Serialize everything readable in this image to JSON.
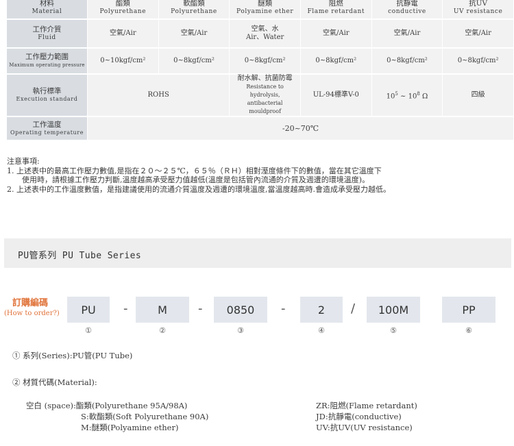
{
  "table": {
    "header_row": {
      "label_zh": "材料",
      "label_en": "Material",
      "cols": [
        {
          "zh": "酯類",
          "en": "Polyurethane"
        },
        {
          "zh": "軟酯類",
          "en": "Polyurethane"
        },
        {
          "zh": "醚類",
          "en": "Polyamine ether"
        },
        {
          "zh": "阻燃",
          "en": "Flame retardant"
        },
        {
          "zh": "抗靜電",
          "en": "conductive"
        },
        {
          "zh": "抗UV",
          "en": "UV resistance"
        }
      ]
    },
    "fluid_row": {
      "label_zh": "工作介質",
      "label_en": "Fluid",
      "cols": [
        "空氣/Air",
        "空氣/Air",
        "空氣、水",
        "空氣/Air",
        "空氣/Air",
        "空氣/Air"
      ],
      "col3_line2": "Air、Water"
    },
    "pressure_row": {
      "label_zh": "工作壓力範圍",
      "label_en": "Maximum operating pressure",
      "cols": [
        "0~10kgf/cm²",
        "0~8kgf/cm²",
        "0~8kgf/cm²",
        "0~8kgf/cm²",
        "0~8kgf/cm²",
        "0~8kgf/cm²"
      ]
    },
    "standard_row": {
      "label_zh": "執行標準",
      "label_en": "Execution standard",
      "rohs": "ROHS",
      "ether_zh": "耐水解、抗菌防霉",
      "ether_en1": "Resistance to hydrolysis,",
      "ether_en2": "antibacterial mouldproof",
      "flame": "UL-94標準V-0",
      "conductive_base1": "10",
      "conductive_exp1": "5",
      "conductive_mid": " ~ 10",
      "conductive_exp2": "8",
      "conductive_unit": " Ω",
      "uv": "四級"
    },
    "temp_row": {
      "label_zh": "工作溫度",
      "label_en": "Operating temperature",
      "value": "-20~70℃"
    }
  },
  "notes": {
    "title": "注意事項:",
    "line1": "1.  上述表中的最高工作壓力數值,是指在２０～２５℃，６５％（ＲＨ）相對溼度條件下的數值，當在其它溫度下",
    "line1b": "使用時，請根據工作壓力判斷,溫度越高承受壓力值越低(溫度是包括管內流通的介質及週遭的環境溫度)。",
    "line2": "2.  上述表中的工作溫度數值，是指建議使用的流通介質溫度及週遭的環境溫度,當溫度越高時.會造成承受壓力越低。"
  },
  "series": {
    "title": "PU管系列 PU Tube Series"
  },
  "order": {
    "label_zh": "訂購編碼",
    "label_en": "(How to order?)",
    "codes": [
      "PU",
      "M",
      "0850",
      "2",
      "100M",
      "PP"
    ],
    "seps": [
      "-",
      "-",
      "-",
      "/"
    ],
    "nums": [
      "①",
      "②",
      "③",
      "④",
      "⑤",
      "⑥"
    ]
  },
  "desc": {
    "item1": "①  系列(Series):PU管(PU Tube)",
    "item2": "②  材質代碼(Material):",
    "mat_left": [
      "空白 (space):酯類(Polyurethane 95A/98A)",
      "S:軟酯類(Soft Polyurethane 90A)",
      "M:醚類(Polyamine ether)"
    ],
    "mat_right": [
      "ZR:阻燃(Flame retardant)",
      "JD:抗靜電(conductive)",
      "UV:抗UV(UV resistance)"
    ]
  }
}
